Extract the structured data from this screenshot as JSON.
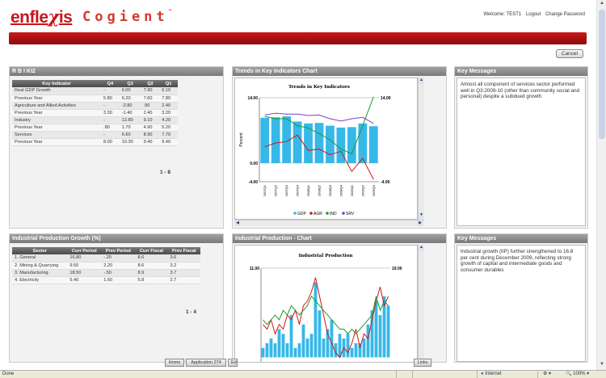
{
  "header": {
    "logo_pre": "enfle",
    "logo_xi": "χ",
    "logo_post": "is",
    "product": "Cogient",
    "trademark": "™",
    "welcome": "Welcome: TEST1",
    "logout": "Logout",
    "change_password": "Change Password"
  },
  "cancel_label": "Cancel",
  "panels": {
    "rbi_title": "R B I KI2",
    "trends_title": "Trends in Key Indicators Chart",
    "key_messages_1_title": "Key Messages",
    "iip_title": "Industrial Production Growth (%)",
    "iip_chart_title": "Industrial Production - Chart",
    "key_messages_2_title": "Key Messages"
  },
  "rbi_table": {
    "headers": [
      "Key Indicator",
      "Q4",
      "Q3",
      "Q2",
      "Q1"
    ],
    "rows": [
      [
        "Real GDP Growth",
        "-",
        "6.00",
        "7.90",
        "6.10"
      ],
      [
        "Previous Year",
        "5.80",
        "6.20",
        "7.60",
        "7.80"
      ],
      [
        "Agriculture and Allied Activities",
        "-",
        "-2.80",
        ".90",
        "2.40"
      ],
      [
        "Previous Year",
        "3.30",
        "-1.40",
        "2.40",
        "3.20"
      ],
      [
        "Industry",
        "-",
        "12.80",
        "9.10",
        "4.20"
      ],
      [
        "Previous Year",
        ".80",
        "1.70",
        "4.90",
        "5.20"
      ],
      [
        "Services",
        "-",
        "6.60",
        "8.90",
        "7.70"
      ],
      [
        "Previous Year",
        "8.00",
        "10.30",
        "9.40",
        "9.40"
      ]
    ],
    "pager": "1 - 8"
  },
  "iip_table": {
    "headers": [
      "Sector",
      "Curr Period",
      "Prev Period",
      "Curr Fiscal",
      "Prev Fiscal"
    ],
    "rows": [
      [
        "1. General",
        "16.80",
        "-.20",
        "8.6",
        "3.6"
      ],
      [
        "2. Mining & Quarrying",
        "9.50",
        "2.20",
        "8.6",
        "3.2"
      ],
      [
        "3. Manufacturing",
        "18.50",
        "-.50",
        "8.9",
        "3.7"
      ],
      [
        "4. Electricity",
        "5.40",
        "1.60",
        "5.8",
        "2.7"
      ]
    ],
    "pager": "1 - 4"
  },
  "messages": {
    "msg1": "Almost all component of services sector performed well in Q3:2009-10 (other than community social and personal) despite a subdued growth",
    "msg2": "Industrial growth (IIP) further strengthened to 16.8 per cent during December 2009, reflecting strong growth of capital and intermediate goods and consumer durables"
  },
  "chart_data": [
    {
      "type": "bar",
      "title": "Trends in Key Indicators",
      "ylabel": "Percent",
      "ylim": [
        -4,
        14
      ],
      "y_ticks": [
        "14.00",
        "0.00",
        "-4.00"
      ],
      "y2_ticks": [
        "14.00",
        "-4.00"
      ],
      "categories": [
        "2007Q1",
        "2007Q2",
        "2007Q3",
        "2007Q4",
        "2008Q1",
        "2008Q2",
        "2008Q3",
        "2008Q4",
        "2009Q1",
        "2009Q2",
        "2009Q3"
      ],
      "series": [
        {
          "name": "GDP",
          "kind": "bar",
          "color": "#36b8e8",
          "values": [
            9.7,
            9.8,
            10.0,
            8.9,
            8.5,
            8.6,
            8.0,
            7.6,
            7.7,
            8.5,
            7.9
          ]
        },
        {
          "name": "AGR",
          "kind": "line",
          "color": "#d01818",
          "values": [
            3.5,
            4.3,
            4.6,
            6.0,
            2.7,
            3.0,
            1.8,
            2.5,
            -1.8,
            1.0,
            -3.5
          ]
        },
        {
          "name": "IND",
          "kind": "line",
          "color": "#1f9a2a",
          "values": [
            10.0,
            9.5,
            9.5,
            8.0,
            7.5,
            6.3,
            5.0,
            3.0,
            2.0,
            8.0,
            14.2
          ]
        },
        {
          "name": "SRV",
          "kind": "line",
          "color": "#7b3cd1",
          "values": [
            10.3,
            10.7,
            10.5,
            10.5,
            10.2,
            10.3,
            9.5,
            9.0,
            9.5,
            9.8,
            8.5
          ]
        }
      ],
      "legend_labels": [
        "GDP",
        "AGR",
        "IND",
        "SRV"
      ],
      "legend": "bottom"
    },
    {
      "type": "bar",
      "title": "Industrial Production",
      "ylim": [
        -2,
        19
      ],
      "y_ticks": [
        "11.00"
      ],
      "y2_ticks": [
        "19.00"
      ],
      "series": [
        {
          "name": "bars",
          "kind": "bar",
          "color": "#36b8e8",
          "values": [
            2,
            3,
            4,
            3,
            6,
            5,
            3,
            9,
            2,
            3,
            7,
            4,
            5,
            16,
            10,
            4,
            6,
            8,
            3,
            5,
            4,
            5,
            2,
            3,
            3,
            4,
            7,
            10,
            12,
            9,
            13,
            11
          ]
        },
        {
          "name": "red",
          "kind": "line",
          "color": "#d01818",
          "values": [
            7,
            6,
            8,
            5,
            7,
            6,
            9,
            8,
            10,
            7,
            11,
            12,
            14,
            17,
            13,
            9,
            5,
            3,
            1,
            0,
            2,
            1,
            3,
            6,
            2,
            5,
            4,
            8,
            12,
            15,
            11,
            13
          ]
        },
        {
          "name": "green",
          "kind": "line",
          "color": "#1f9a2a",
          "values": [
            8,
            7,
            8,
            9,
            8,
            10,
            9,
            11,
            10,
            9,
            10,
            11,
            13,
            12,
            11,
            10,
            9,
            8,
            7,
            6,
            6,
            5,
            6,
            5,
            6,
            7,
            8,
            9,
            13,
            10,
            12,
            11
          ]
        }
      ]
    }
  ],
  "taskbar": [
    "Home",
    "Application 274",
    "Ed",
    "Links"
  ],
  "status": {
    "done": "Done",
    "zone": "Internet",
    "zoom": "100%"
  }
}
